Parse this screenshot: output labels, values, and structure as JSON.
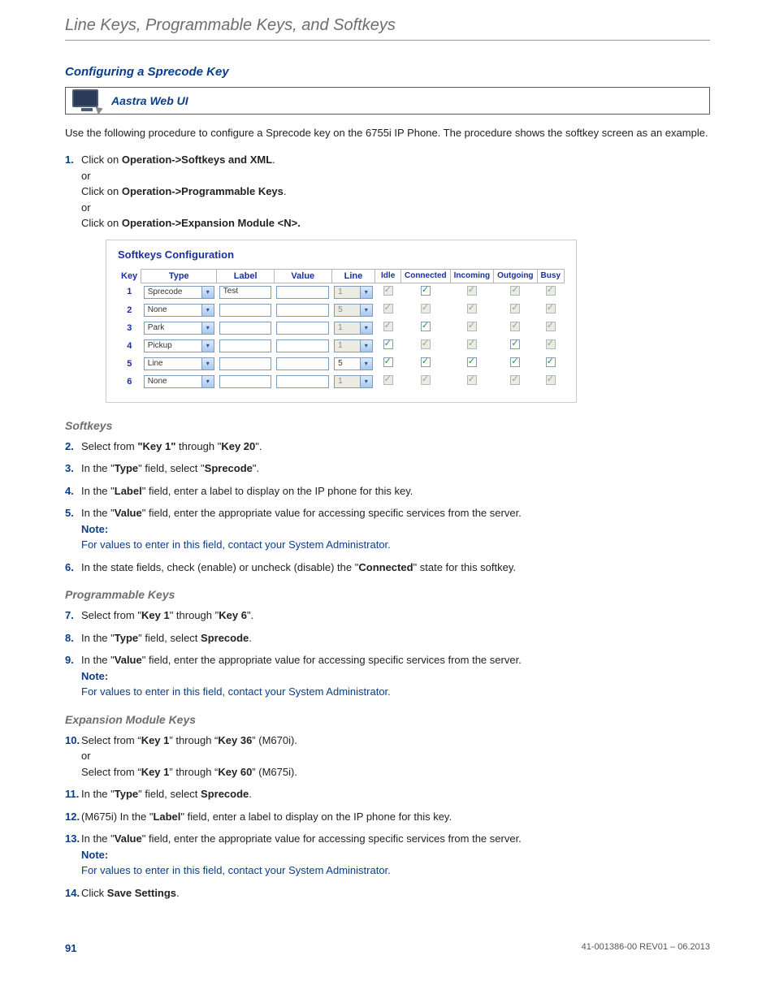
{
  "running_head": "Line Keys, Programmable Keys, and Softkeys",
  "section_title": "Configuring a Sprecode Key",
  "callout_title": "Aastra Web UI",
  "intro": "Use the following procedure to configure a Sprecode key on the 6755i IP Phone. The procedure shows the softkey screen as an example.",
  "step1": {
    "num": "1.",
    "a_pre": "Click on ",
    "a_bold": "Operation->Softkeys and XML",
    "a_post": ".",
    "or": "or",
    "b_pre": "Click on ",
    "b_bold": "Operation->Programmable Keys",
    "b_post": ".",
    "c_pre": "Click on ",
    "c_bold": "Operation->Expansion Module <N>."
  },
  "sk_table": {
    "title": "Softkeys Configuration",
    "headers": {
      "key": "Key",
      "type": "Type",
      "label": "Label",
      "value": "Value",
      "line": "Line"
    },
    "state_headers": [
      "Idle",
      "Connected",
      "Incoming",
      "Outgoing",
      "Busy"
    ],
    "rows": [
      {
        "key": "1",
        "type": "Sprecode",
        "label": "Test",
        "value": "",
        "line": "1",
        "line_disabled": true,
        "states": [
          {
            "c": true,
            "d": true
          },
          {
            "c": true,
            "d": false
          },
          {
            "c": true,
            "d": true
          },
          {
            "c": true,
            "d": true
          },
          {
            "c": true,
            "d": true
          }
        ]
      },
      {
        "key": "2",
        "type": "None",
        "label": "",
        "value": "",
        "line": "5",
        "line_disabled": true,
        "states": [
          {
            "c": true,
            "d": true
          },
          {
            "c": true,
            "d": true
          },
          {
            "c": true,
            "d": true
          },
          {
            "c": true,
            "d": true
          },
          {
            "c": true,
            "d": true
          }
        ]
      },
      {
        "key": "3",
        "type": "Park",
        "label": "",
        "value": "",
        "line": "1",
        "line_disabled": true,
        "states": [
          {
            "c": true,
            "d": true
          },
          {
            "c": true,
            "d": false
          },
          {
            "c": true,
            "d": true
          },
          {
            "c": true,
            "d": true
          },
          {
            "c": true,
            "d": true
          }
        ]
      },
      {
        "key": "4",
        "type": "Pickup",
        "label": "",
        "value": "",
        "line": "1",
        "line_disabled": true,
        "states": [
          {
            "c": true,
            "d": false
          },
          {
            "c": true,
            "d": true
          },
          {
            "c": true,
            "d": true
          },
          {
            "c": true,
            "d": false
          },
          {
            "c": true,
            "d": true
          }
        ]
      },
      {
        "key": "5",
        "type": "Line",
        "label": "",
        "value": "",
        "line": "5",
        "line_disabled": false,
        "states": [
          {
            "c": true,
            "d": false
          },
          {
            "c": true,
            "d": false
          },
          {
            "c": true,
            "d": false
          },
          {
            "c": true,
            "d": false
          },
          {
            "c": true,
            "d": false
          }
        ]
      },
      {
        "key": "6",
        "type": "None",
        "label": "",
        "value": "",
        "line": "1",
        "line_disabled": true,
        "states": [
          {
            "c": true,
            "d": true
          },
          {
            "c": true,
            "d": true
          },
          {
            "c": true,
            "d": true
          },
          {
            "c": true,
            "d": true
          },
          {
            "c": true,
            "d": true
          }
        ]
      }
    ]
  },
  "softkeys_heading": "Softkeys",
  "step2": {
    "num": "2.",
    "pre": "Select from ",
    "b1": "\"Key 1\"",
    "mid": " through \"",
    "b2": "Key 20",
    "post": "\"."
  },
  "step3": {
    "num": "3.",
    "pre": "In the \"",
    "b1": "Type",
    "mid": "\" field, select \"",
    "b2": "Sprecode",
    "post": "\"."
  },
  "step4": {
    "num": "4.",
    "pre": "In the \"",
    "b1": "Label",
    "post": "\" field, enter a label to display on the IP phone for this key."
  },
  "step5": {
    "num": "5.",
    "pre": "In the \"",
    "b1": "Value",
    "post": "\" field, enter the appropriate value for accessing specific services from the server.",
    "note_label": "Note:",
    "note_text": "For values to enter in this field, contact your System Administrator."
  },
  "step6": {
    "num": "6.",
    "pre": "In the state fields, check (enable) or uncheck (disable) the \"",
    "b1": "Connected",
    "post": "\" state for this softkey."
  },
  "prog_heading": "Programmable Keys",
  "step7": {
    "num": "7.",
    "pre": "Select from \"",
    "b1": "Key 1",
    "mid": "\" through \"",
    "b2": "Key 6",
    "post": "\"."
  },
  "step8": {
    "num": "8.",
    "pre": "In the \"",
    "b1": "Type",
    "mid": "\" field, select ",
    "b2": "Sprecode",
    "post": "."
  },
  "step9": {
    "num": "9.",
    "pre": "In the \"",
    "b1": "Value",
    "post": "\" field, enter the appropriate value for accessing specific services from the server.",
    "note_label": "Note:",
    "note_text": "For values to enter in this field, contact your System Administrator."
  },
  "exp_heading": "Expansion Module Keys",
  "step10": {
    "num": "10.",
    "pre": "Select from “",
    "b1": "Key 1",
    "mid": "” through “",
    "b2": "Key 36",
    "post": "” (M670i).",
    "or": "or",
    "pre2": "Select from “",
    "b3": "Key 1",
    "mid2": "” through “",
    "b4": "Key 60",
    "post2": "” (M675i)."
  },
  "step11": {
    "num": "11.",
    "pre": "In the \"",
    "b1": "Type",
    "mid": "\" field, select ",
    "b2": "Sprecode",
    "post": "."
  },
  "step12": {
    "num": "12.",
    "pre": "(M675i) In the \"",
    "b1": "Label",
    "post": "\" field, enter a label to display on the IP phone for this key."
  },
  "step13": {
    "num": "13.",
    "pre": "In the \"",
    "b1": "Value",
    "post": "\" field, enter the appropriate value for accessing specific services from the server.",
    "note_label": "Note:",
    "note_text": "For values to enter in this field, contact your System Administrator."
  },
  "step14": {
    "num": "14.",
    "pre": "Click ",
    "b1": "Save Settings",
    "post": "."
  },
  "footer": {
    "page": "91",
    "rev": "41-001386-00 REV01 – 06.2013"
  }
}
